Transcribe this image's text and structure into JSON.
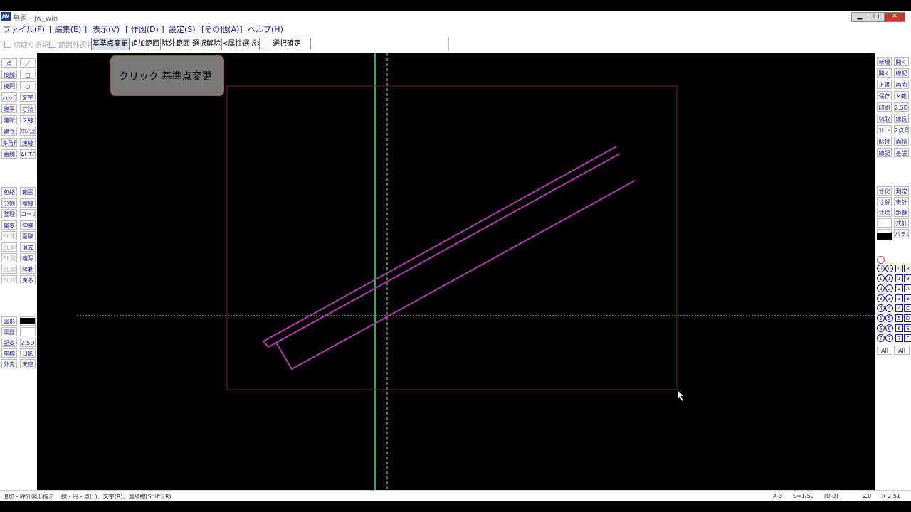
{
  "window": {
    "title": "無題 - jw_win",
    "icon_label": "jw",
    "buttons": {
      "minimize": "▁",
      "maximize": "□",
      "close": "✕"
    }
  },
  "menu": [
    "ファイル(F)",
    "[ 編集(E) ]",
    "表示(V)",
    "[ 作図(D) ]",
    "設定(S)",
    "[その他(A)]",
    "ヘルプ(H)"
  ],
  "toolbar": {
    "check1_label": "切取り選択",
    "check2_label": "範囲外選択",
    "buttons": [
      "基準点変更",
      "追加範囲",
      "除外範囲",
      "選択解除",
      "<属性選択>"
    ],
    "confirm_label": "選択確定"
  },
  "left_tools": [
    [
      "点",
      "／"
    ],
    [
      "接線",
      "□"
    ],
    [
      "接円",
      "○"
    ],
    [
      "ハッチ",
      "文字"
    ],
    [
      "建平",
      "寸法"
    ],
    [
      "建断",
      "２線"
    ],
    [
      "建立",
      "中心線"
    ],
    [
      "多角形",
      "連線"
    ],
    [
      "曲線",
      "AUTO"
    ]
  ],
  "left_tools2": [
    [
      "包絡",
      "範囲"
    ],
    [
      "分割",
      "複線"
    ],
    [
      "整理",
      "コーナー"
    ],
    [
      "属変",
      "伸縮"
    ],
    [
      "BL化",
      "面取"
    ],
    [
      "BL解",
      "消去"
    ],
    [
      "BL属",
      "複写"
    ],
    [
      "BL編",
      "移動"
    ],
    [
      "BL終",
      "戻る"
    ]
  ],
  "left_tools3": [
    [
      "図形",
      ""
    ],
    [
      "図登",
      ""
    ],
    [
      "記変",
      "2.5D"
    ],
    [
      "座標",
      "日影"
    ],
    [
      "外変",
      "天空"
    ]
  ],
  "right_tools": [
    [
      "新規",
      "開く"
    ],
    [
      "開く",
      "線記"
    ],
    [
      "上書",
      "画面"
    ],
    [
      "保存",
      "×範"
    ],
    [
      "印刷",
      "2.5D"
    ],
    [
      "切取",
      "線長"
    ],
    [
      "ｺﾋﾟｰ",
      "2点角"
    ],
    [
      "貼付",
      "面積"
    ],
    [
      "線記",
      "基設"
    ]
  ],
  "right_tools2": [
    [
      "寸化",
      "測定"
    ],
    [
      "寸解",
      "表計"
    ],
    [
      "寸除",
      "距離"
    ],
    [
      "",
      "式計"
    ],
    [
      "",
      "パラメ"
    ]
  ],
  "layer_groups": [
    "0",
    "1",
    "2",
    "3",
    "4",
    "5",
    "6",
    "7"
  ],
  "layers": [
    "0",
    "1",
    "2",
    "3",
    "4",
    "5",
    "6",
    "7",
    "8",
    "9",
    "A",
    "B",
    "C",
    "D",
    "E",
    "F"
  ],
  "layer_all_label": "All",
  "tooltip": {
    "text": "クリック 基準点変更"
  },
  "status": {
    "hint": "追加・除外図形指示",
    "hint2": "線・円・点(L)、文字(R)、連続線[Shift](R)",
    "paper": "A-3",
    "scale": "S=1/50",
    "layer": "[0-0]",
    "angle": "∠0",
    "zoom": "× 2.51"
  },
  "colors": {
    "canvas": "#000000",
    "frame": "#7a1f1f",
    "drawing": "#b03ab0",
    "axis_v": "#1fb84a",
    "guide": "#c8c8c8"
  }
}
